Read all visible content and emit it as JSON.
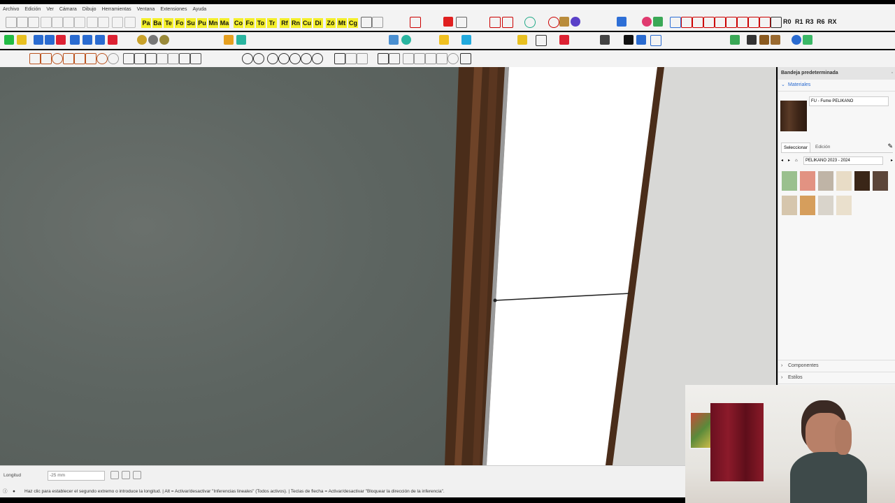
{
  "menu": [
    "Archivo",
    "Edición",
    "Ver",
    "Cámara",
    "Dibujo",
    "Herramientas",
    "Ventana",
    "Extensiones",
    "Ayuda"
  ],
  "toolbar_labels": [
    "Pa",
    "Ba",
    "Te",
    "Fo",
    "Su",
    "Pu",
    "Mn",
    "Ma",
    "Co",
    "Fo",
    "To",
    "Tr",
    "Rf",
    "Rn",
    "Cu",
    "Di",
    "Zó",
    "Mt",
    "Cg"
  ],
  "toolbar_right": [
    "R0",
    "R1",
    "R3",
    "R6",
    "RX"
  ],
  "panel": {
    "title": "Bandeja predeterminada",
    "materials_label": "Materiales",
    "material_name": "FU - Fume PELIKANO",
    "tab_select": "Seleccionar",
    "tab_edit": "Edición",
    "library": "PELIKANO 2023 - 2024",
    "components": "Componentes",
    "styles": "Estilos",
    "swatch_colors": [
      "#9ac08e",
      "#e29282",
      "#bfb4a6",
      "#e8dcc6",
      "#3a2618",
      "#5c463a",
      "#d6c6ad",
      "#d69e5c",
      "#d9d4cb",
      "#eae0cd"
    ]
  },
  "status": {
    "measure_label": "Longitud",
    "measure_value": "-25 mm",
    "hint": "Haz clic para establecer el segundo extremo o introduce la longitud. | Alt = Activar/desactivar \"Inferencias lineales\" (Todos activos). | Teclas de flecha = Activar/desactivar \"Bloquear la dirección de la inferencia\"."
  }
}
